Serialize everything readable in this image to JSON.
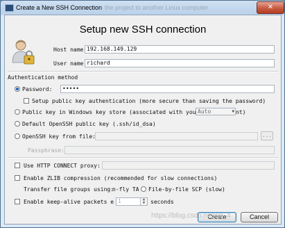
{
  "window": {
    "title": "Create a New SSH Connection",
    "title_ghost": "the project to another Linux computer",
    "close_label": "✕"
  },
  "heading": "Setup new SSH connection",
  "host": {
    "label": "Host name:",
    "value": "192.168.149.129"
  },
  "user": {
    "label": "User name:",
    "value": "richard"
  },
  "auth": {
    "section_label": "Authentication method",
    "password_label": "Password:",
    "password_value": "•••••",
    "save_password_label": "Setup public key authentication (more secure than saving the password)",
    "windows_key_label": "Public key in Windows key store (associated with you",
    "windows_key_tail": "nt)",
    "windows_key_select": "Auto",
    "default_key_label": "Default OpenSSH public key (.ssh/id_dsa)",
    "file_key_label": "OpenSSH key from file:",
    "browse_label": "...",
    "passphrase_label": "Passphrase:"
  },
  "options": {
    "http_proxy_label": "Use HTTP CONNECT proxy:",
    "zlib_label": "Enable ZLIB compression (recommended for slow connections)",
    "transfer_label": "Transfer file groups using:",
    "transfer_option1": "n-fly TA",
    "transfer_option2": "File-by-file SCP (slow)",
    "keepalive_label": "Enable keep-alive packets e",
    "keepalive_value": "1",
    "keepalive_unit": "seconds"
  },
  "buttons": {
    "create": "Create",
    "cancel": "Cancel"
  },
  "watermark": "https://blog.csdn.net/qq_4"
}
